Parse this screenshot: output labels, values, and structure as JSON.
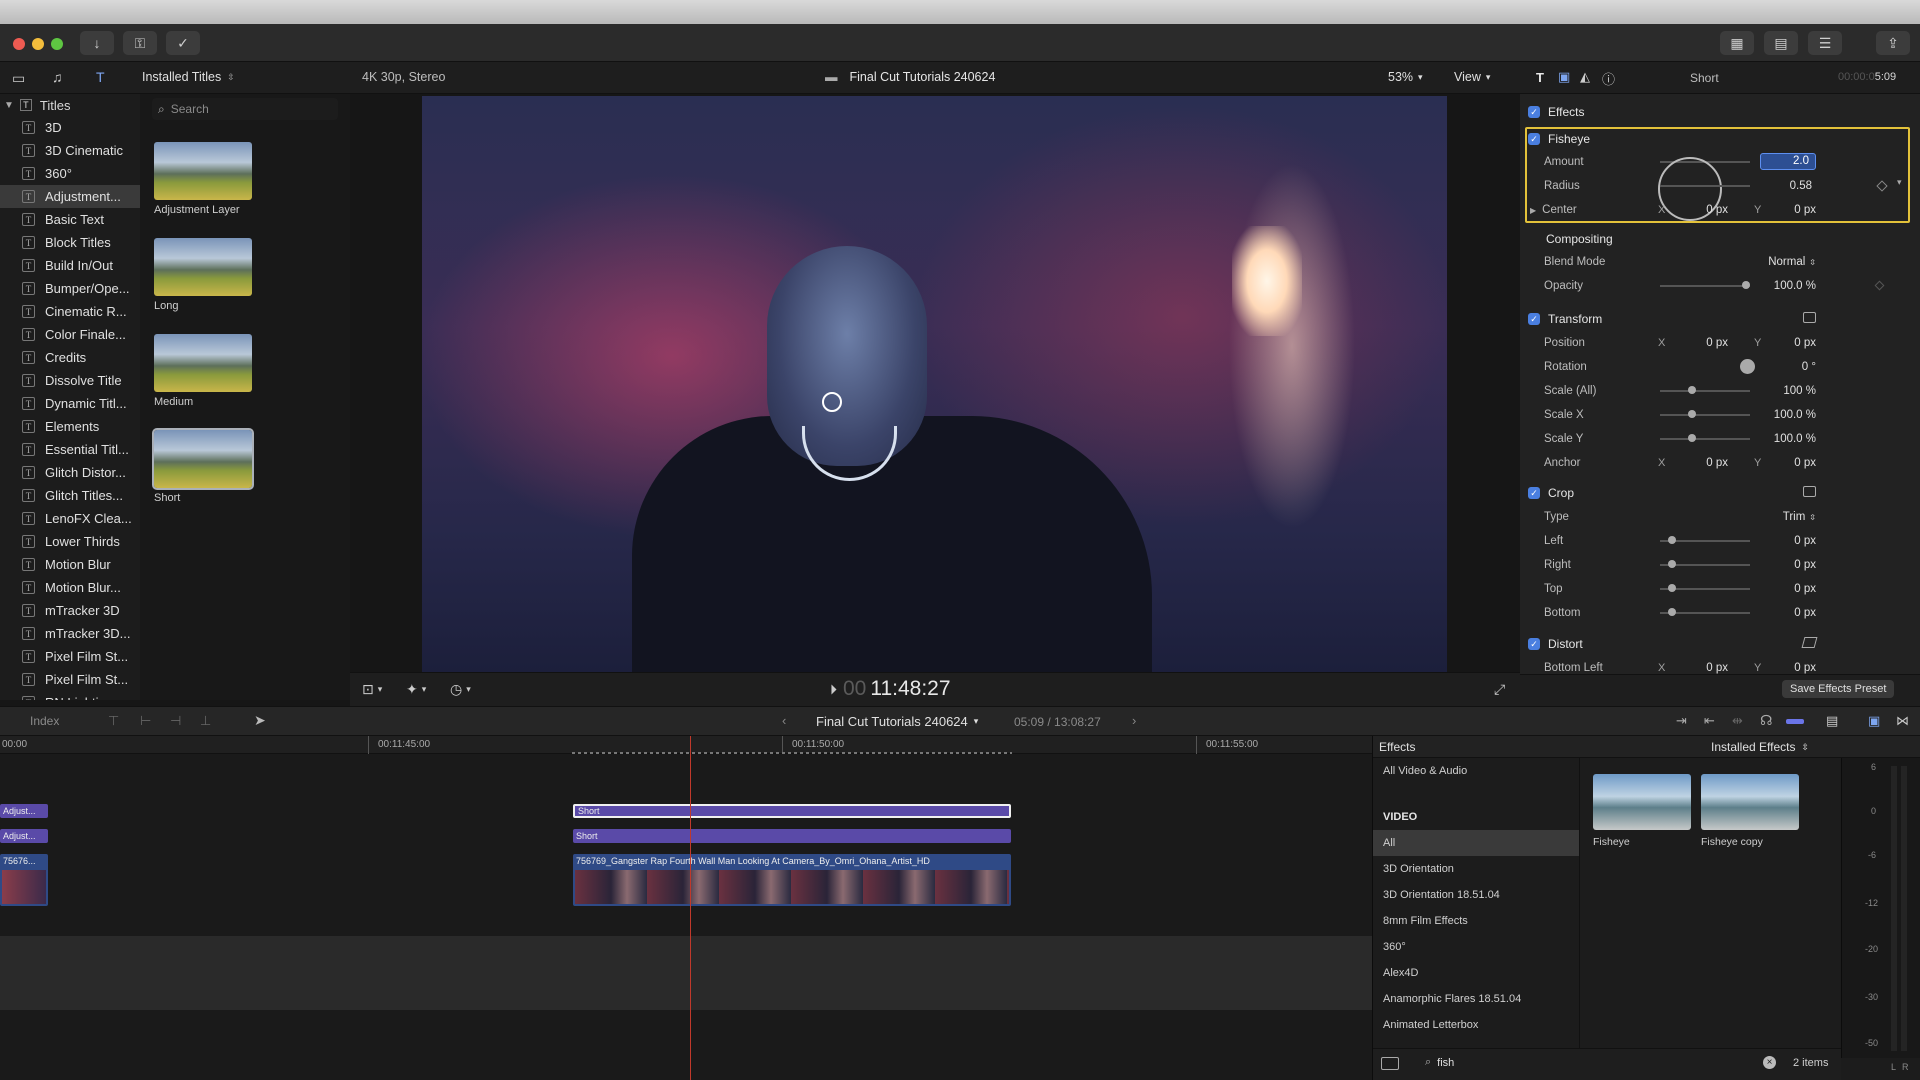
{
  "browser": {
    "title": "Installed Titles",
    "search_placeholder": "Search",
    "root": "Titles",
    "categories": [
      "3D",
      "3D Cinematic",
      "360°",
      "Adjustment...",
      "Basic Text",
      "Block Titles",
      "Build In/Out",
      "Bumper/Ope...",
      "Cinematic R...",
      "Color Finale...",
      "Credits",
      "Dissolve Title",
      "Dynamic Titl...",
      "Elements",
      "Essential Titl...",
      "Glitch Distor...",
      "Glitch Titles...",
      "LenoFX Clea...",
      "Lower Thirds",
      "Motion Blur",
      "Motion Blur...",
      "mTracker 3D",
      "mTracker 3D...",
      "Pixel Film St...",
      "Pixel Film St...",
      "RN Lighting..."
    ],
    "selected_category": "Adjustment...",
    "thumbnails": [
      "Adjustment Layer",
      "Long",
      "Medium",
      "Short"
    ]
  },
  "viewer": {
    "format": "4K 30p, Stereo",
    "project": "Final Cut Tutorials 240624",
    "zoom": "53%",
    "view": "View",
    "timecode_dim": "00",
    "timecode": "11:48:27"
  },
  "inspector": {
    "clip_name": "Short",
    "duration_dim": "00:00:0",
    "duration": "5:09",
    "effects_label": "Effects",
    "fisheye": {
      "label": "Fisheye",
      "amount_label": "Amount",
      "amount": "2.0",
      "radius_label": "Radius",
      "radius": "0.58",
      "center_label": "Center",
      "center_x": "0 px",
      "center_y": "0 px"
    },
    "compositing": {
      "label": "Compositing",
      "blend_label": "Blend Mode",
      "blend": "Normal",
      "opacity_label": "Opacity",
      "opacity": "100.0 %"
    },
    "transform": {
      "label": "Transform",
      "position_label": "Position",
      "pos_x": "0 px",
      "pos_y": "0 px",
      "rotation_label": "Rotation",
      "rotation": "0 °",
      "scale_all_label": "Scale (All)",
      "scale_all": "100 %",
      "scale_x_label": "Scale X",
      "scale_x": "100.0 %",
      "scale_y_label": "Scale Y",
      "scale_y": "100.0 %",
      "anchor_label": "Anchor",
      "anchor_x": "0 px",
      "anchor_y": "0 px"
    },
    "crop": {
      "label": "Crop",
      "type_label": "Type",
      "type": "Trim",
      "left_label": "Left",
      "left": "0 px",
      "right_label": "Right",
      "right": "0 px",
      "top_label": "Top",
      "top": "0 px",
      "bottom_label": "Bottom",
      "bottom": "0 px"
    },
    "distort": {
      "label": "Distort",
      "bottom_left_label": "Bottom Left",
      "bl_x": "0 px",
      "bl_y": "0 px"
    },
    "x": "X",
    "y": "Y",
    "save_preset": "Save Effects Preset"
  },
  "timeline": {
    "index": "Index",
    "project": "Final Cut Tutorials 240624",
    "position": "05:09 / 13:08:27",
    "ruler": [
      "00:00",
      "00:11:45:00",
      "00:11:50:00",
      "00:11:55:00"
    ],
    "clips": {
      "adjust_1": "Adjust...",
      "adjust_2": "Adjust...",
      "short_top": "Short",
      "short_2": "Short",
      "video_left": "75676...",
      "video_main": "756769_Gangster Rap Fourth Wall Man Looking At Camera_By_Omri_Ohana_Artist_HD"
    }
  },
  "effects_browser": {
    "title": "Effects",
    "source": "Installed Effects",
    "top_item": "All Video & Audio",
    "video_header": "VIDEO",
    "categories": [
      "All",
      "3D Orientation",
      "3D Orientation 18.51.04",
      "8mm Film Effects",
      "360°",
      "Alex4D",
      "Anamorphic Flares 18.51.04",
      "Animated Letterbox"
    ],
    "selected": "All",
    "results": [
      "Fisheye",
      "Fisheye copy"
    ],
    "search_value": "fish",
    "count": "2 items",
    "meter_ticks": [
      "6",
      "0",
      "-6",
      "-12",
      "-20",
      "-30",
      "-50"
    ],
    "meter_lr": [
      "L",
      "R"
    ]
  },
  "colors": {
    "accent": "#4a7fe0",
    "title_clip": "#5a4aa8",
    "highlight_box": "#e3c23a"
  }
}
